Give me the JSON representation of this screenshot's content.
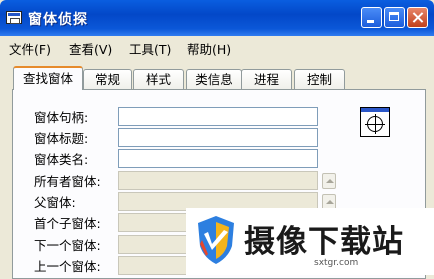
{
  "window": {
    "title": "窗体侦探"
  },
  "menu": [
    "文件(F)",
    "查看(V)",
    "工具(T)",
    "帮助(H)"
  ],
  "tabs": [
    "查找窗体",
    "常规",
    "样式",
    "类信息",
    "进程",
    "控制"
  ],
  "fields": [
    {
      "label": "窗体句柄:",
      "value": ""
    },
    {
      "label": "窗体标题:",
      "value": ""
    },
    {
      "label": "窗体类名:",
      "value": ""
    },
    {
      "label": "所有者窗体:",
      "value": ""
    },
    {
      "label": "父窗体:",
      "value": ""
    },
    {
      "label": "首个子窗体:",
      "value": ""
    },
    {
      "label": "下一个窗体:",
      "value": ""
    },
    {
      "label": "上一个窗体:",
      "value": ""
    }
  ],
  "icons": {
    "finder": "window-finder-target-icon",
    "goto": "up-arrow-icon"
  },
  "watermark": {
    "title": "摄像下载站",
    "url": "sxtgr.com"
  },
  "colors": {
    "titlebar": "#0348c8",
    "active_tab_accent": "#e68b2c",
    "panel": "#fcfcfe",
    "close": "#c0401c"
  }
}
